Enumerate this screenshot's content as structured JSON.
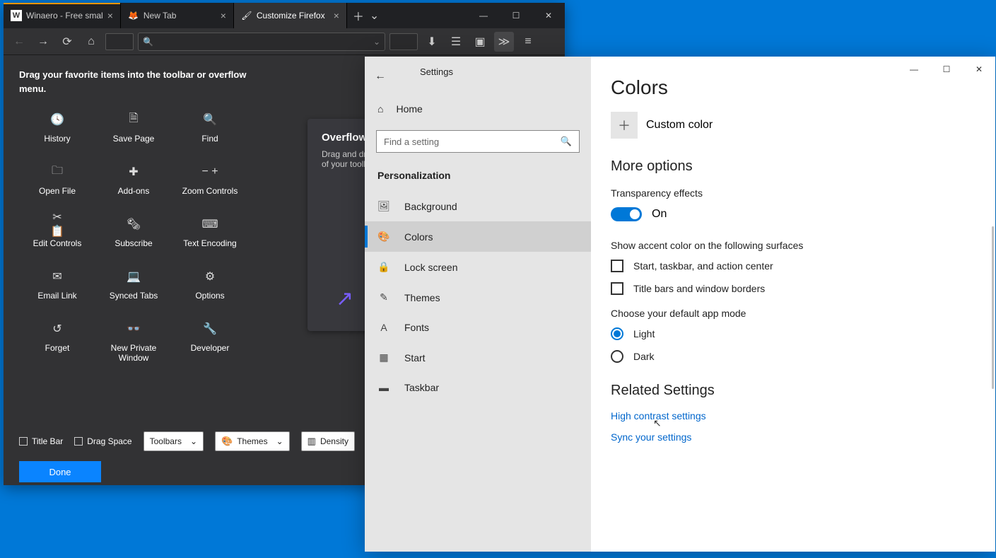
{
  "firefox": {
    "tabs": [
      {
        "title": "Winaero - Free smal",
        "icon": "W"
      },
      {
        "title": "New Tab",
        "icon": "🦊"
      },
      {
        "title": "Customize Firefox",
        "icon": "🖌"
      }
    ],
    "instruction": "Drag your favorite items into the toolbar or overflow menu.",
    "items": [
      "History",
      "Save Page",
      "Find",
      "Open File",
      "Add-ons",
      "Zoom Controls",
      "Edit Controls",
      "Subscribe",
      "Text Encoding",
      "Email Link",
      "Synced Tabs",
      "Options",
      "Forget",
      "New Private Window",
      "Developer"
    ],
    "overflow": {
      "title": "Overflow",
      "text": "Drag and drop items here to keep them within reach but out of your toolbar…"
    },
    "bottom": {
      "titlebar": "Title Bar",
      "dragspace": "Drag Space",
      "toolbars": "Toolbars",
      "themes": "Themes",
      "density": "Density",
      "done": "Done"
    }
  },
  "settings": {
    "title": "Settings",
    "home": "Home",
    "search_placeholder": "Find a setting",
    "section": "Personalization",
    "nav": [
      "Background",
      "Colors",
      "Lock screen",
      "Themes",
      "Fonts",
      "Start",
      "Taskbar"
    ],
    "page": {
      "heading": "Colors",
      "custom_color": "Custom color",
      "more_options": "More options",
      "transparency_label": "Transparency effects",
      "transparency_state": "On",
      "accent_label": "Show accent color on the following surfaces",
      "cb1": "Start, taskbar, and action center",
      "cb2": "Title bars and window borders",
      "mode_label": "Choose your default app mode",
      "mode_light": "Light",
      "mode_dark": "Dark",
      "related": "Related Settings",
      "link1": "High contrast settings",
      "link2": "Sync your settings"
    }
  }
}
